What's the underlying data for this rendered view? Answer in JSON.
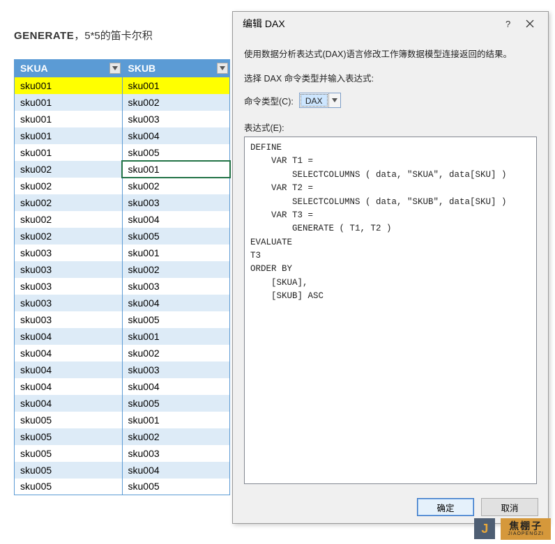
{
  "title": {
    "bold": "GENERATE",
    "rest": "，5*5的笛卡尔积"
  },
  "table": {
    "headers": [
      "SKUA",
      "SKUB"
    ],
    "highlighted_row_index": 0,
    "selected_cell": {
      "row": 5,
      "col": 1
    },
    "rows": [
      [
        "sku001",
        "sku001"
      ],
      [
        "sku001",
        "sku002"
      ],
      [
        "sku001",
        "sku003"
      ],
      [
        "sku001",
        "sku004"
      ],
      [
        "sku001",
        "sku005"
      ],
      [
        "sku002",
        "sku001"
      ],
      [
        "sku002",
        "sku002"
      ],
      [
        "sku002",
        "sku003"
      ],
      [
        "sku002",
        "sku004"
      ],
      [
        "sku002",
        "sku005"
      ],
      [
        "sku003",
        "sku001"
      ],
      [
        "sku003",
        "sku002"
      ],
      [
        "sku003",
        "sku003"
      ],
      [
        "sku003",
        "sku004"
      ],
      [
        "sku003",
        "sku005"
      ],
      [
        "sku004",
        "sku001"
      ],
      [
        "sku004",
        "sku002"
      ],
      [
        "sku004",
        "sku003"
      ],
      [
        "sku004",
        "sku004"
      ],
      [
        "sku004",
        "sku005"
      ],
      [
        "sku005",
        "sku001"
      ],
      [
        "sku005",
        "sku002"
      ],
      [
        "sku005",
        "sku003"
      ],
      [
        "sku005",
        "sku004"
      ],
      [
        "sku005",
        "sku005"
      ]
    ]
  },
  "dialog": {
    "title": "编辑 DAX",
    "intro": "使用数据分析表达式(DAX)语言修改工作簿数据模型连接返回的结果。",
    "select_label": "选择 DAX 命令类型并输入表达式:",
    "cmd_type_label": "命令类型(C):",
    "cmd_type_value": "DAX",
    "expr_label": "表达式(E):",
    "expression": "DEFINE\n    VAR T1 =\n        SELECTCOLUMNS ( data, \"SKUA\", data[SKU] )\n    VAR T2 =\n        SELECTCOLUMNS ( data, \"SKUB\", data[SKU] )\n    VAR T3 =\n        GENERATE ( T1, T2 )\nEVALUATE\nT3\nORDER BY\n    [SKUA],\n    [SKUB] ASC",
    "ok_label": "确定",
    "cancel_label": "取消"
  },
  "watermark": {
    "letter": "J",
    "big": "焦棚子",
    "small": "JIAOPENGZI"
  }
}
